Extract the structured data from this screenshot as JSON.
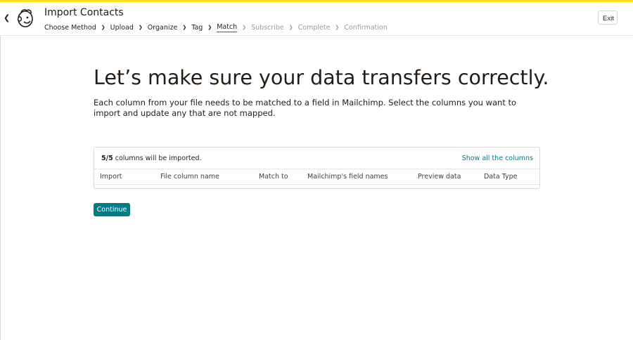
{
  "header": {
    "title": "Import Contacts",
    "exit_label": "Exit",
    "steps": [
      {
        "label": "Choose Method",
        "state": "done"
      },
      {
        "label": "Upload",
        "state": "done"
      },
      {
        "label": "Organize",
        "state": "done"
      },
      {
        "label": "Tag",
        "state": "done"
      },
      {
        "label": "Match",
        "state": "current"
      },
      {
        "label": "Subscribe",
        "state": "future"
      },
      {
        "label": "Complete",
        "state": "future"
      },
      {
        "label": "Confirmation",
        "state": "future"
      }
    ]
  },
  "main": {
    "headline": "Let’s make sure your data transfers correctly.",
    "intro": "Each column from your file needs to be matched to a field in Mailchimp. Select the columns you want to import and update any that are not mapped.",
    "summary": {
      "count": "5/5",
      "text": " columns will be imported."
    },
    "show_all_label": "Show all the columns",
    "columns": [
      "Import",
      "File column name",
      "Match to",
      "Mailchimp's field names",
      "Preview data",
      "Data Type"
    ],
    "continue_label": "Continue"
  },
  "colors": {
    "accent_yellow": "#ffe01b",
    "teal": "#007c89",
    "text": "#241c15",
    "muted": "#9b9b9b"
  },
  "icons": {
    "back": "chevron-left-icon",
    "logo": "mailchimp-freddie-logo",
    "step_separator": "chevron-right-icon"
  }
}
